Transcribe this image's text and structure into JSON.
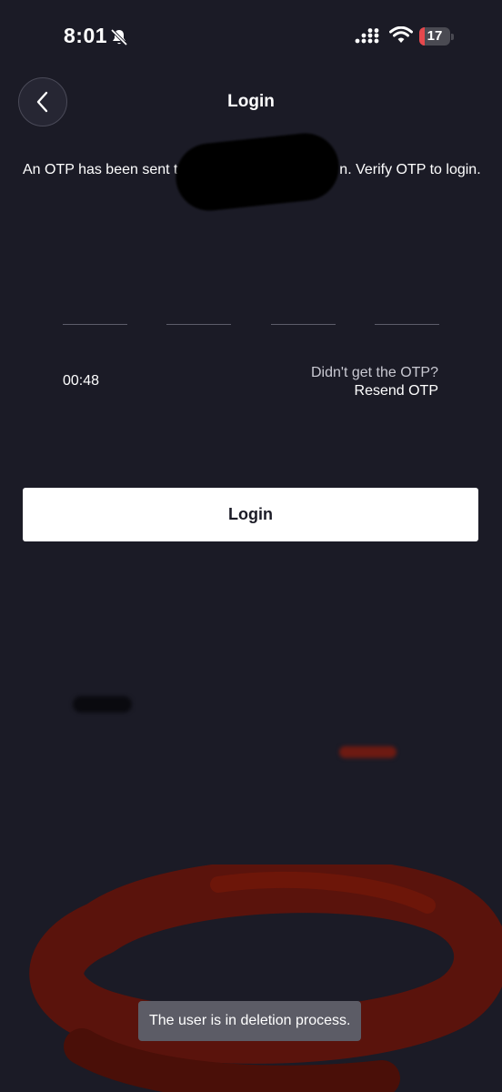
{
  "status_bar": {
    "time": "8:01",
    "battery_level": "17",
    "icons": [
      "bell-slash-icon",
      "signal-icon",
      "wifi-icon",
      "battery-icon"
    ]
  },
  "header": {
    "back_icon": "chevron-left-icon",
    "title": "Login"
  },
  "otp": {
    "message": "An OTP has been sent to                                      n. Verify OTP to login.",
    "digit_count": 4,
    "timer": "00:48",
    "resend_hint": "Didn't get the OTP?",
    "resend_label": "Resend OTP"
  },
  "login_button": {
    "label": "Login"
  },
  "toast": {
    "message": "The user is in deletion process."
  },
  "colors": {
    "background": "#1b1b26",
    "button_bg": "#ffffff",
    "button_text": "#1b1b26",
    "toast_bg": "#5c5c66",
    "scribble_red": "#7a1408"
  }
}
